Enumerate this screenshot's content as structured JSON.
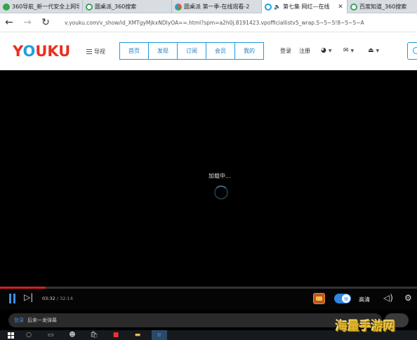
{
  "browser": {
    "tabs": [
      {
        "title": "360导航_新一代安全上网导",
        "favicon_color": "#31a745",
        "active": false
      },
      {
        "title": "圆桌派_360搜索",
        "favicon_color": "#3aa55a",
        "active": false
      },
      {
        "title": "圆桌派 第一季-在线观看-2",
        "favicon_color": "#e9573f",
        "active": false
      },
      {
        "title": "第七集 网红—在线",
        "favicon_color": "#1fa0e0",
        "active": true
      },
      {
        "title": "百度知道_360搜索",
        "favicon_color": "#3aa55a",
        "active": false
      }
    ],
    "address": "v.youku.com/v_show/id_XMTgyMjkxNDIyOA==.html?spm=a2h0j.8191423.vpofficiallistv5_wrap.5~5~5!8~5~5~A"
  },
  "header": {
    "logo": "YOUKU",
    "guide": "导视",
    "nav": [
      "首页",
      "发现",
      "订阅",
      "会员",
      "我的"
    ],
    "login": "登录",
    "register": "注册"
  },
  "player": {
    "loading": "加载中...",
    "current_time": "03:32",
    "separator": "/",
    "duration": "32:14",
    "progress": 0.11,
    "danmu_toggle": "弹",
    "quality": "高清",
    "danmu_login": "登录",
    "danmu_placeholder": "后来一发弹幕"
  },
  "watermark": "海量手游网",
  "colors": {
    "accent": "#1f9be0",
    "logo_red": "#e8301f",
    "progress_red": "#d81e1e",
    "control_blue": "#3d8fe6"
  }
}
